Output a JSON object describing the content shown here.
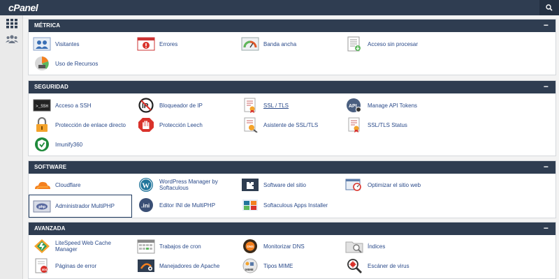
{
  "app": {
    "logo": "cPanel"
  },
  "sections": [
    {
      "title": "MÉTRICA",
      "items": [
        "Visitantes",
        "Errores",
        "Banda ancha",
        "Acceso sin procesar",
        "Uso de Recursos"
      ]
    },
    {
      "title": "SEGURIDAD",
      "items": [
        "Acceso a SSH",
        "Bloqueador de IP",
        "SSL / TLS",
        "Manage API Tokens",
        "Protección de enlace directo",
        "Protección Leech",
        "Asistente de SSL/TLS",
        "SSL/TLS Status",
        "Imunify360"
      ]
    },
    {
      "title": "SOFTWARE",
      "items": [
        "Cloudflare",
        "WordPress Manager by Softaculous",
        "Software del sitio",
        "Optimizar el sitio web",
        "Administrador MultiPHP",
        "Editor INI de MultiPHP",
        "Softaculous Apps Installer"
      ]
    },
    {
      "title": "AVANZADA",
      "items": [
        "LiteSpeed Web Cache Manager",
        "Trabajos de cron",
        "Monitorizar DNS",
        "Índices",
        "Páginas de error",
        "Manejadores de Apache",
        "Tipos MIME",
        "Escáner de virus"
      ]
    }
  ],
  "icon_text": {
    "ssh": ">_SSH",
    "api": "API",
    "ini": ".ini",
    "php": "php",
    "dns": "DNS",
    "mime": "MIME",
    "err": "404"
  },
  "colors": {
    "header": "#2f3d51",
    "link": "#2a4a8a",
    "accent_red": "#d9322b",
    "accent_orange": "#f4801f"
  }
}
